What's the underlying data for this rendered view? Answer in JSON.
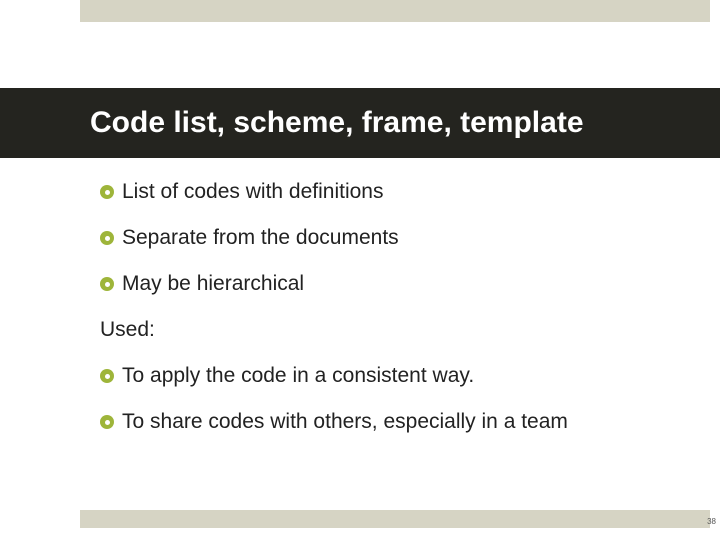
{
  "slide": {
    "title": "Code list, scheme, frame, template",
    "bullets_a": [
      "List of codes with definitions",
      "Separate from the documents",
      "May be hierarchical"
    ],
    "used_label": "Used:",
    "bullets_b": [
      "To apply the code in a consistent way.",
      "To share codes with others, especially in a team"
    ],
    "page_number": "38"
  }
}
